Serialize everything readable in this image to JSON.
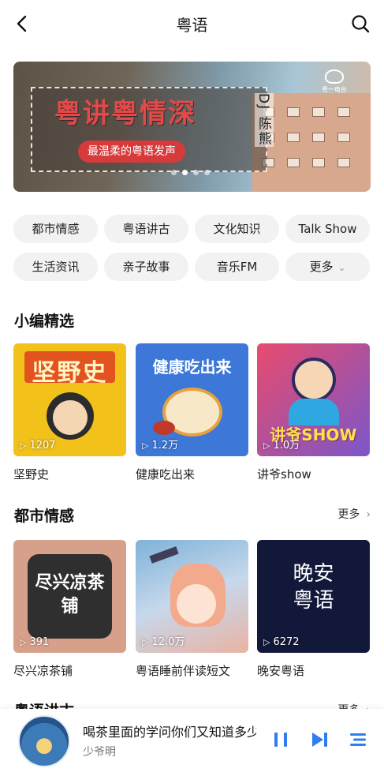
{
  "header": {
    "title": "粤语"
  },
  "banner": {
    "main_text": "粤讲粤情深",
    "sub_text": "最温柔的粤语发声",
    "side_text": "DJ 陈熊",
    "logo_text": "粤一电台",
    "slide_count": 4,
    "active_slide": 2
  },
  "categories": [
    "都市情感",
    "粤语讲古",
    "文化知识",
    "Talk Show",
    "生活资讯",
    "亲子故事",
    "音乐FM",
    "更多"
  ],
  "editor_picks": {
    "title": "小编精选",
    "items": [
      {
        "name": "坚野史",
        "plays": "1207",
        "cover_text": "坚野史"
      },
      {
        "name": "健康吃出来",
        "plays": "1.2万",
        "cover_text": "健康吃出来"
      },
      {
        "name": "讲爷show",
        "plays": "1.0万",
        "cover_text": "讲爷SHOW"
      }
    ]
  },
  "urban_emotion": {
    "title": "都市情感",
    "more_label": "更多",
    "items": [
      {
        "name": "尽兴凉茶铺",
        "plays": "391",
        "cover_text": "尽兴凉茶铺"
      },
      {
        "name": "粤语睡前伴读短文",
        "plays": "12.0万",
        "cover_text": ""
      },
      {
        "name": "晚安粤语",
        "plays": "6272",
        "cover_text": "晚安粤语"
      }
    ]
  },
  "next_section": {
    "title": "粤语讲古",
    "more_label": "更多"
  },
  "player": {
    "title": "喝茶里面的学问你们又知道多少",
    "author": "少爷明"
  },
  "colors": {
    "accent": "#2f7df0",
    "banner_red": "#d73a3a"
  },
  "icons": [
    "back-arrow-icon",
    "search-icon",
    "chevron-down-icon",
    "chevron-right-icon",
    "play-icon",
    "pause-icon",
    "skip-next-icon",
    "playlist-icon"
  ]
}
